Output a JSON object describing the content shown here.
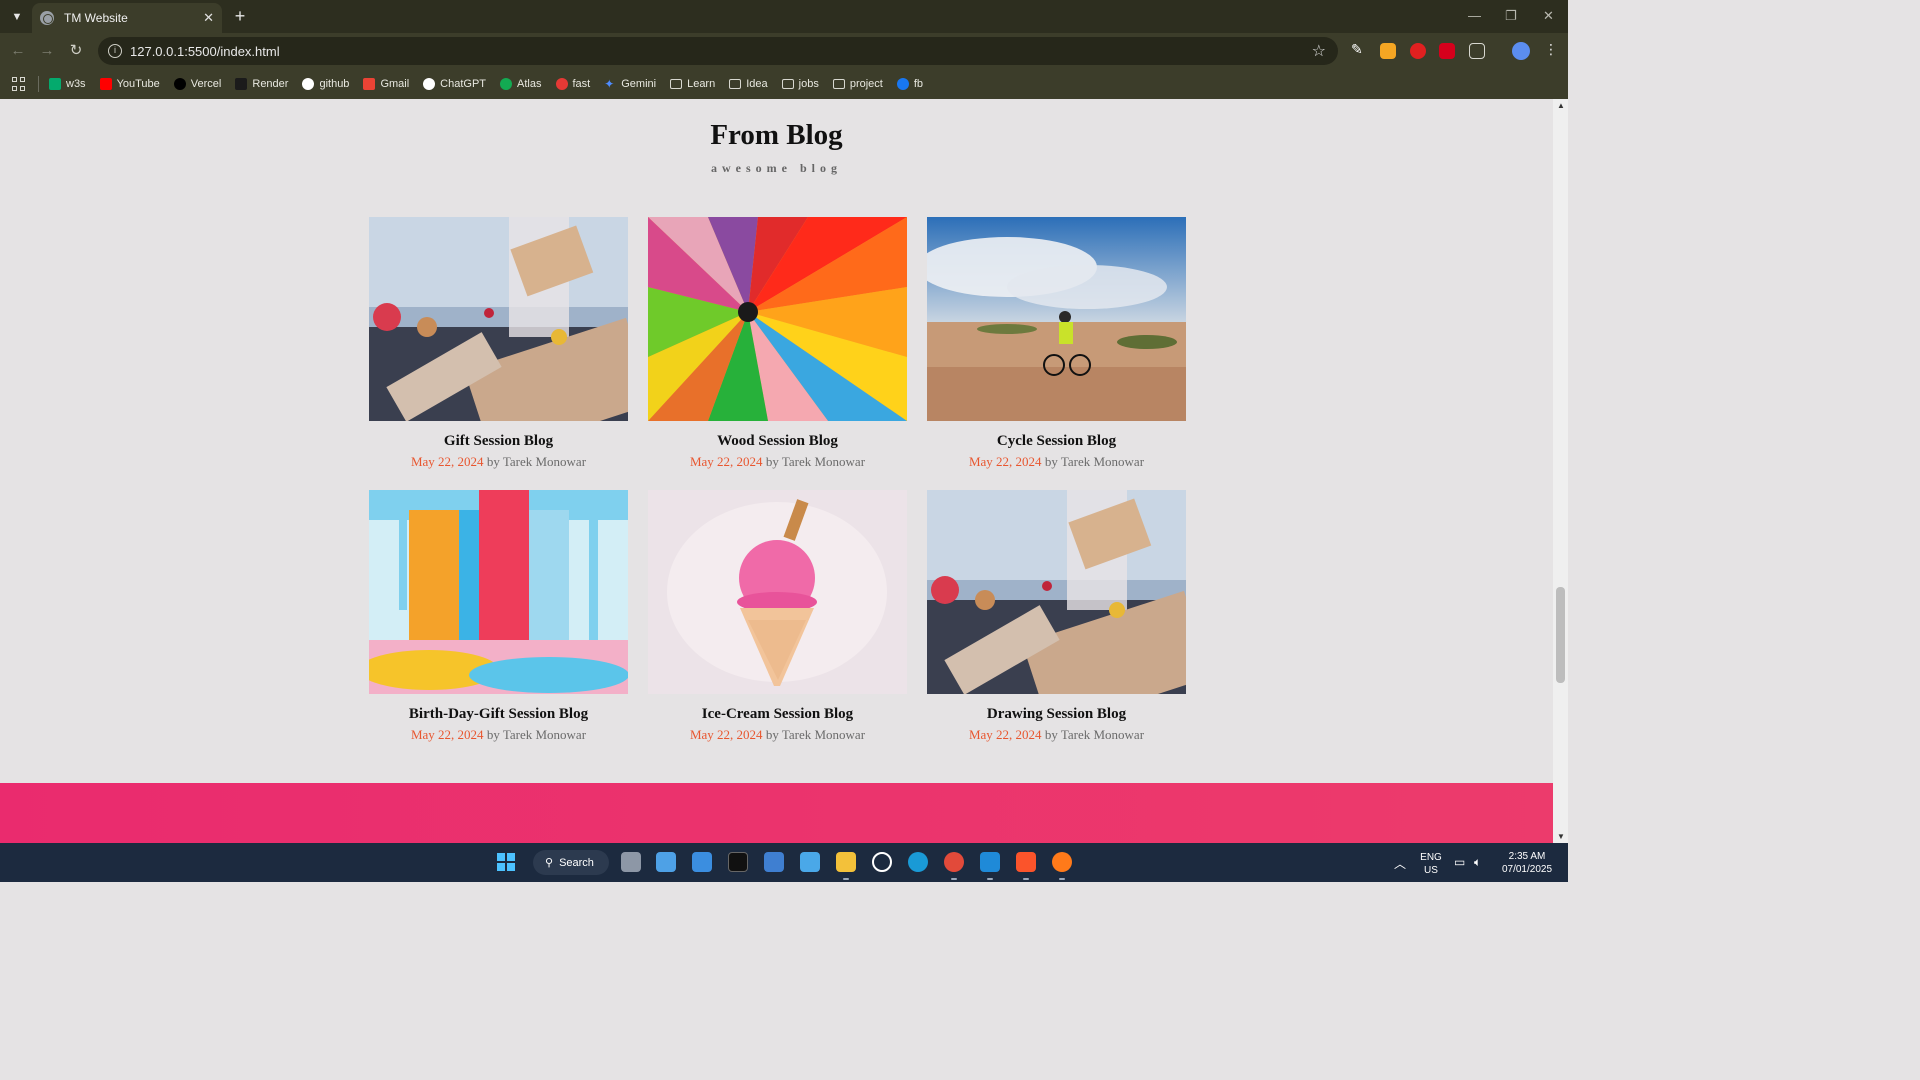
{
  "browser": {
    "tab_title": "TM Website",
    "tab_close": "✕",
    "new_tab": "+",
    "url": "127.0.0.1:5500/index.html",
    "bookmarks": [
      {
        "label": "w3s",
        "color": "#04aa6d"
      },
      {
        "label": "YouTube",
        "color": "#ff0000"
      },
      {
        "label": "Vercel",
        "color": "#000000"
      },
      {
        "label": "Render",
        "color": "#222222"
      },
      {
        "label": "github",
        "color": "#ffffff"
      },
      {
        "label": "Gmail",
        "color": "#ea4335"
      },
      {
        "label": "ChatGPT",
        "color": "#ffffff"
      },
      {
        "label": "Atlas",
        "color": "#13aa52"
      },
      {
        "label": "fast",
        "color": "#e53935"
      },
      {
        "label": "Gemini",
        "color": "#4e8cff"
      },
      {
        "label": "Learn",
        "color": "folder"
      },
      {
        "label": "Idea",
        "color": "folder"
      },
      {
        "label": "jobs",
        "color": "folder"
      },
      {
        "label": "project",
        "color": "folder"
      },
      {
        "label": "fb",
        "color": "#1877f2"
      }
    ]
  },
  "blog": {
    "title": "From Blog",
    "subtitle": "awesome blog",
    "posts": [
      {
        "title": "Gift Session Blog",
        "date": "May 22, 2024",
        "by": " by ",
        "author": "Tarek Monowar",
        "image": "gift-photo"
      },
      {
        "title": "Wood Session Blog",
        "date": "May 22, 2024",
        "by": " by ",
        "author": "Tarek Monowar",
        "image": "colored-pencils-photo"
      },
      {
        "title": "Cycle Session Blog",
        "date": "May 22, 2024",
        "by": " by ",
        "author": "Tarek Monowar",
        "image": "cyclist-photo"
      },
      {
        "title": "Birth-Day-Gift Session Blog",
        "date": "May 22, 2024",
        "by": " by ",
        "author": "Tarek Monowar",
        "image": "paint-drip-photo"
      },
      {
        "title": "Ice-Cream Session Blog",
        "date": "May 22, 2024",
        "by": " by ",
        "author": "Tarek Monowar",
        "image": "ice-cream-photo"
      },
      {
        "title": "Drawing Session Blog",
        "date": "May 22, 2024",
        "by": " by ",
        "author": "Tarek Monowar",
        "image": "gift-photo"
      }
    ]
  },
  "taskbar": {
    "search_label": "Search",
    "lang": "ENG",
    "region": "US",
    "time": "2:35 AM",
    "date": "07/01/2025"
  },
  "colors": {
    "accent_date": "#e8562f",
    "footer_band": "#ea2b6e",
    "chrome_bg": "#3c3d2a"
  }
}
